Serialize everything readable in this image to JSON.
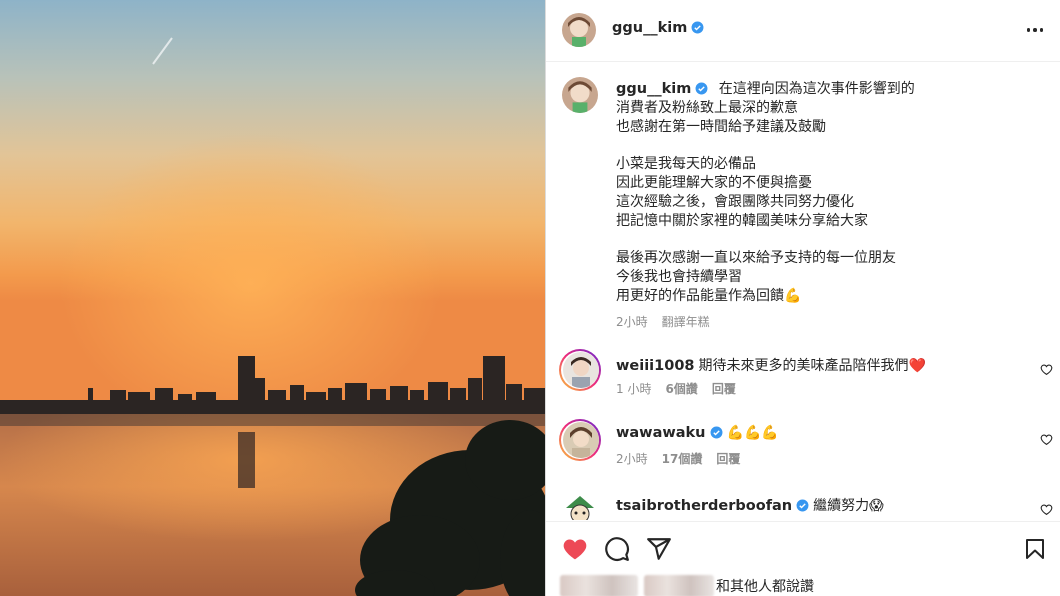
{
  "post": {
    "author": "ggu__kim",
    "caption_lines": [
      "在這裡向因為這次事件影響到的",
      "消費者及粉絲致上最深的歉意",
      "也感謝在第一時間給予建議及鼓勵",
      "",
      "小菜是我每天的必備品",
      "因此更能理解大家的不便與擔憂",
      "這次經驗之後，會跟團隊共同努力優化",
      "把記憶中關於家裡的韓國美味分享給大家",
      "",
      "最後再次感謝一直以來給予支持的每一位朋友",
      "今後我也會持續學習",
      "用更好的作品能量作為回饋"
    ],
    "caption_emoji": "💪",
    "time": "2小時",
    "translate": "翻譯年糕"
  },
  "comments": [
    {
      "user": "weiii1008",
      "verified": false,
      "text": "期待未來更多的美味產品陪伴我們",
      "emoji": "❤️",
      "time": "1 小時",
      "likes": "6個讚",
      "reply": "回覆"
    },
    {
      "user": "wawawaku",
      "verified": true,
      "text": "",
      "emoji": "💪💪💪",
      "time": "2小時",
      "likes": "17個讚",
      "reply": "回覆"
    },
    {
      "user": "tsaibrotherderboofan",
      "verified": true,
      "text": "繼續努力",
      "emoji": "😱",
      "time": "",
      "likes": "",
      "reply": ""
    }
  ],
  "likes_text": "和其他人都說讚",
  "colors": {
    "verified": "#3897f0",
    "heart": "#ed4956",
    "muted": "#8e8e8e"
  },
  "icons": [
    "more-icon",
    "verified-icon",
    "heart-icon",
    "comment-icon",
    "share-icon",
    "bookmark-icon"
  ]
}
